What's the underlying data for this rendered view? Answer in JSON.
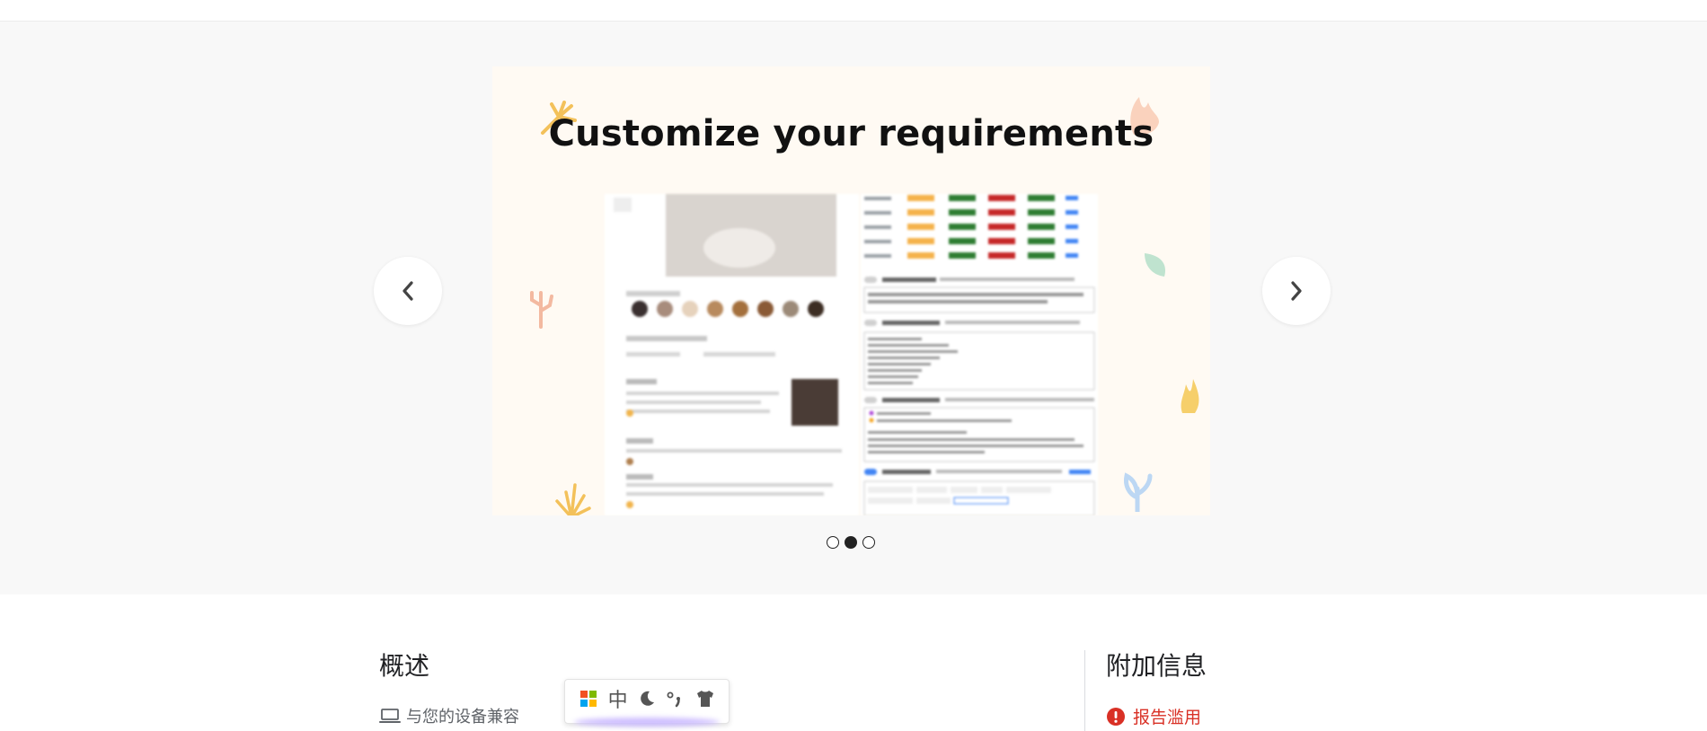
{
  "carousel": {
    "slide_title": "Customize your requirements",
    "prev_label": "Previous",
    "next_label": "Next",
    "slide_count": 3,
    "active_index": 1
  },
  "overview": {
    "title": "概述",
    "compat_text": "与您的设备兼容"
  },
  "additional_info": {
    "title": "附加信息",
    "report_label": "报告滥用"
  },
  "ime_toolbar": {
    "mode_char": "中",
    "items": [
      "windows-grid-icon",
      "chinese-mode",
      "moon-icon",
      "punctuation-icon",
      "shirt-icon"
    ]
  },
  "colors": {
    "band_bg": "#f8f8f8",
    "slide_bg": "#fffaf3",
    "report_red": "#d93025",
    "text_primary": "#202124",
    "text_secondary": "#5f6368"
  }
}
